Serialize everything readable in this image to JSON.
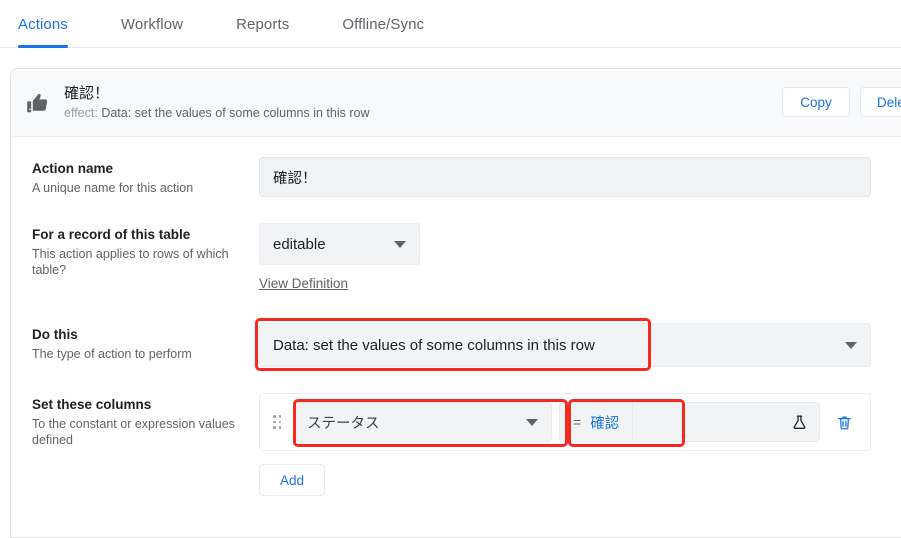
{
  "tabs": [
    {
      "label": "Actions",
      "active": true
    },
    {
      "label": "Workflow",
      "active": false
    },
    {
      "label": "Reports",
      "active": false
    },
    {
      "label": "Offline/Sync",
      "active": false
    }
  ],
  "card": {
    "icon": "thumbs-up-icon",
    "title": "確認！",
    "effect_label": "effect:",
    "effect_value": "Data: set the values of some columns in this row",
    "copy_label": "Copy",
    "delete_label": "Delete"
  },
  "fields": {
    "action_name": {
      "label": "Action name",
      "description": "A unique name for this action",
      "value": "確認！",
      "placeholder": ""
    },
    "for_table": {
      "label": "For a record of this table",
      "description": "This action applies to rows of which table?",
      "value": "editable",
      "link": "View Definition"
    },
    "do_this": {
      "label": "Do this",
      "description": "The type of action to perform",
      "value": "Data: set the values of some columns in this row"
    },
    "set_columns": {
      "label": "Set these columns",
      "description": "To the constant or expression values defined",
      "rows": [
        {
          "column": "ステータス",
          "operator": "=",
          "value": "確認",
          "flask_icon": "flask-icon",
          "delete_icon": "trash-icon",
          "drag_icon": "drag-handle-icon"
        }
      ],
      "add_label": "Add"
    }
  },
  "colors": {
    "accent": "#1a73e8",
    "highlight": "#f5291f",
    "field_bg": "#f1f3f4",
    "header_bg": "#f8f9fa",
    "text": "#202124",
    "muted": "#5f6368"
  }
}
